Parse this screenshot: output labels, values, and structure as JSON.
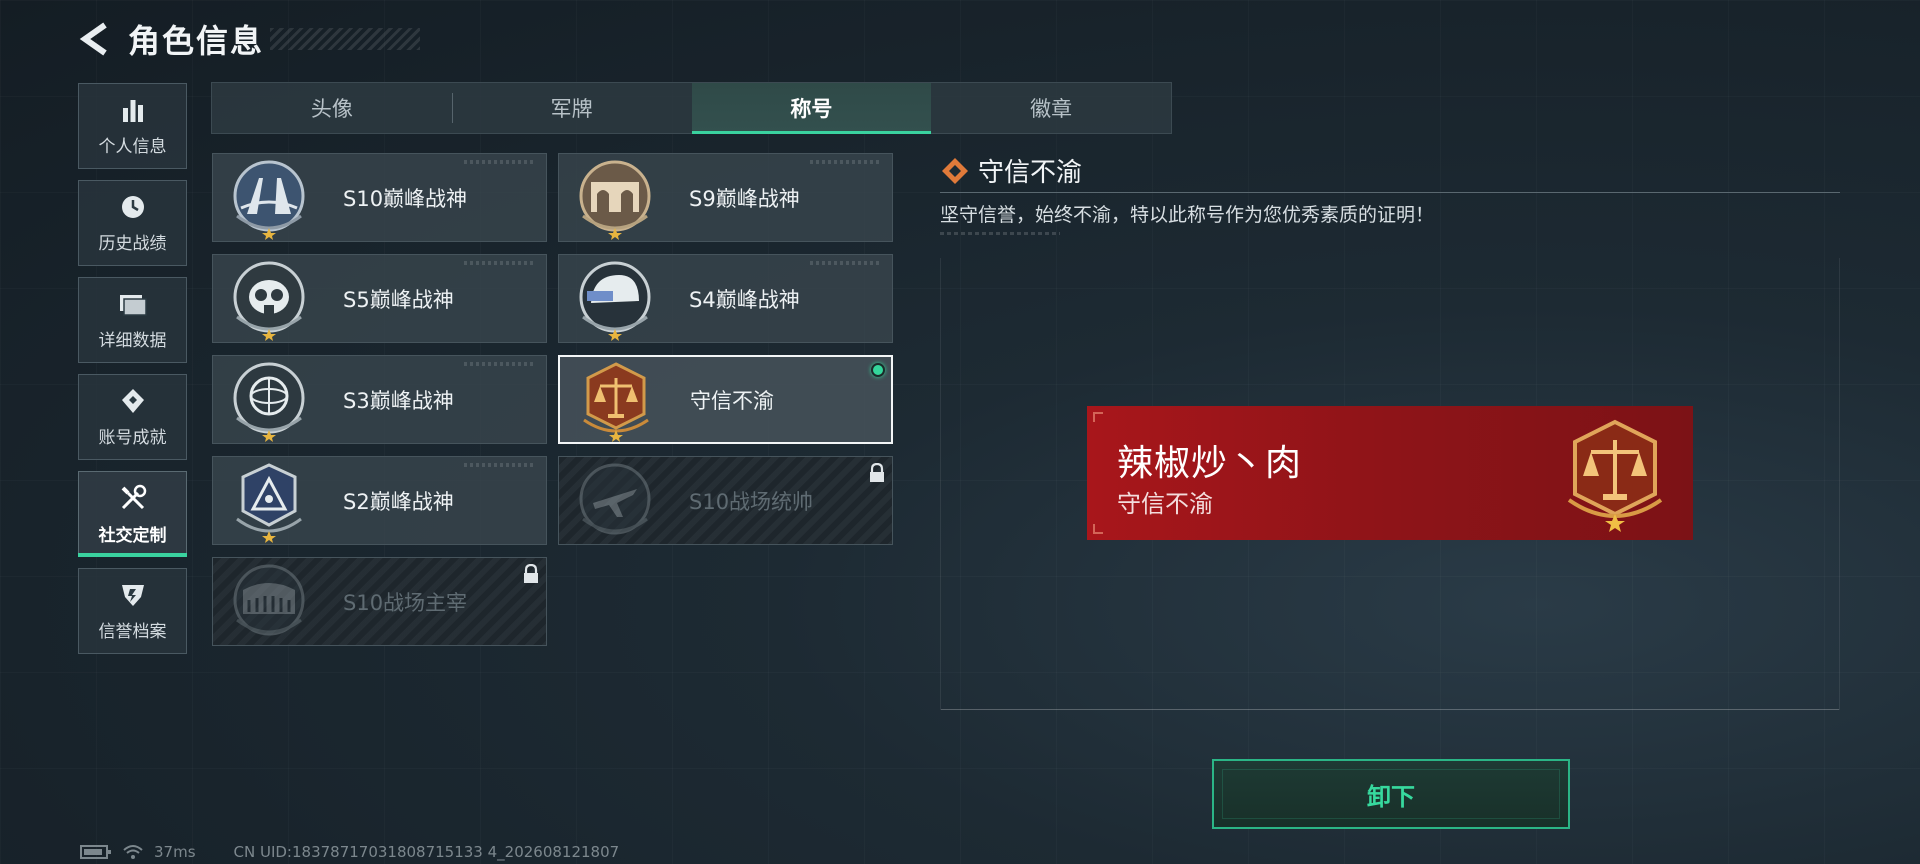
{
  "header": {
    "title": "角色信息"
  },
  "sidebar": {
    "items": [
      {
        "label": "个人信息",
        "icon": "bar-chart-icon"
      },
      {
        "label": "历史战绩",
        "icon": "clock-icon"
      },
      {
        "label": "详细数据",
        "icon": "folder-icon"
      },
      {
        "label": "账号成就",
        "icon": "achievement-icon"
      },
      {
        "label": "社交定制",
        "icon": "tools-icon",
        "active": true
      },
      {
        "label": "信誉档案",
        "icon": "shield-icon"
      }
    ]
  },
  "tabs": [
    {
      "label": "头像"
    },
    {
      "label": "军牌"
    },
    {
      "label": "称号",
      "active": true
    },
    {
      "label": "徽章"
    }
  ],
  "titles": [
    {
      "name": "S10巅峰战神",
      "emblem": "bridge-emblem-icon",
      "state": "unlocked"
    },
    {
      "name": "S9巅峰战神",
      "emblem": "ruins-emblem-icon",
      "state": "unlocked"
    },
    {
      "name": "S5巅峰战神",
      "emblem": "gasmask-emblem-icon",
      "state": "unlocked"
    },
    {
      "name": "S4巅峰战神",
      "emblem": "helmet-emblem-icon",
      "state": "unlocked"
    },
    {
      "name": "S3巅峰战神",
      "emblem": "globe-emblem-icon",
      "state": "unlocked"
    },
    {
      "name": "守信不渝",
      "emblem": "scales-emblem-icon",
      "state": "selected",
      "equipped": true
    },
    {
      "name": "S2巅峰战神",
      "emblem": "triangle-emblem-icon",
      "state": "unlocked"
    },
    {
      "name": "S10战场统帅",
      "emblem": "aircraft-emblem-icon",
      "state": "locked"
    },
    {
      "name": "S10战场主宰",
      "emblem": "colosseum-emblem-icon",
      "state": "locked"
    }
  ],
  "detail": {
    "title": "守信不渝",
    "description": "坚守信誉，始终不渝，特以此称号作为您优秀素质的证明！",
    "nameplate": {
      "player_name": "辣椒炒丶肉",
      "title": "守信不渝"
    }
  },
  "actions": {
    "unequip_label": "卸下"
  },
  "status": {
    "ping": "37ms",
    "uid": "CN UID:18378717031808715133 4_202608121807"
  },
  "colors": {
    "accent": "#3ad29f",
    "nameplate": "#a8161b",
    "gold": "#c98a3a"
  }
}
